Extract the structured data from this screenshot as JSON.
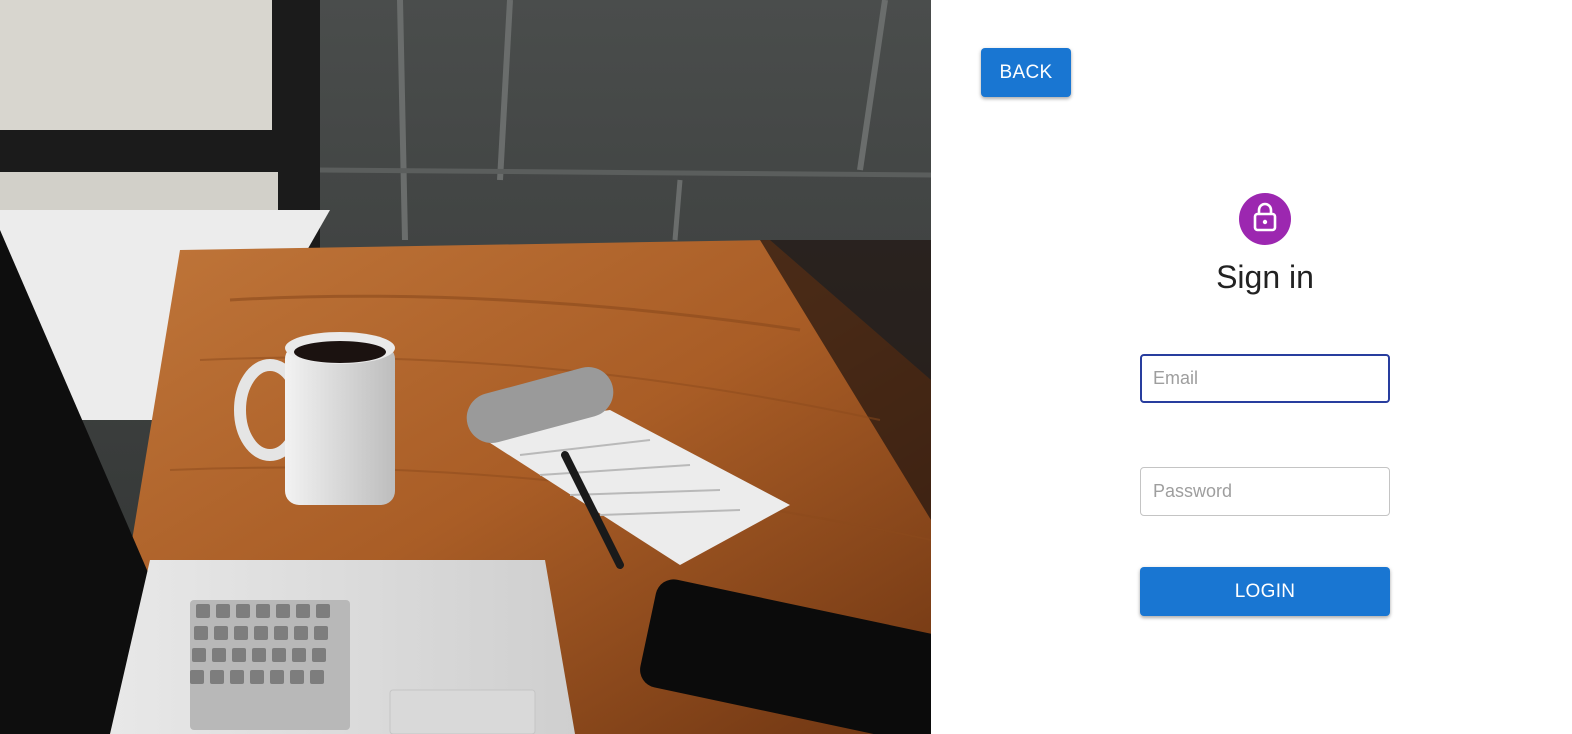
{
  "hero": {
    "image_icon": "workspace-photo"
  },
  "header": {
    "back_label": "BACK"
  },
  "form": {
    "avatar_icon": "lock-icon",
    "title": "Sign in",
    "email_placeholder": "Email",
    "email_value": "",
    "password_placeholder": "Password",
    "password_value": "",
    "login_label": "LOGIN"
  },
  "colors": {
    "primary": "#1976d2",
    "avatar": "#9c27b0",
    "focus_border": "#283d9e"
  }
}
